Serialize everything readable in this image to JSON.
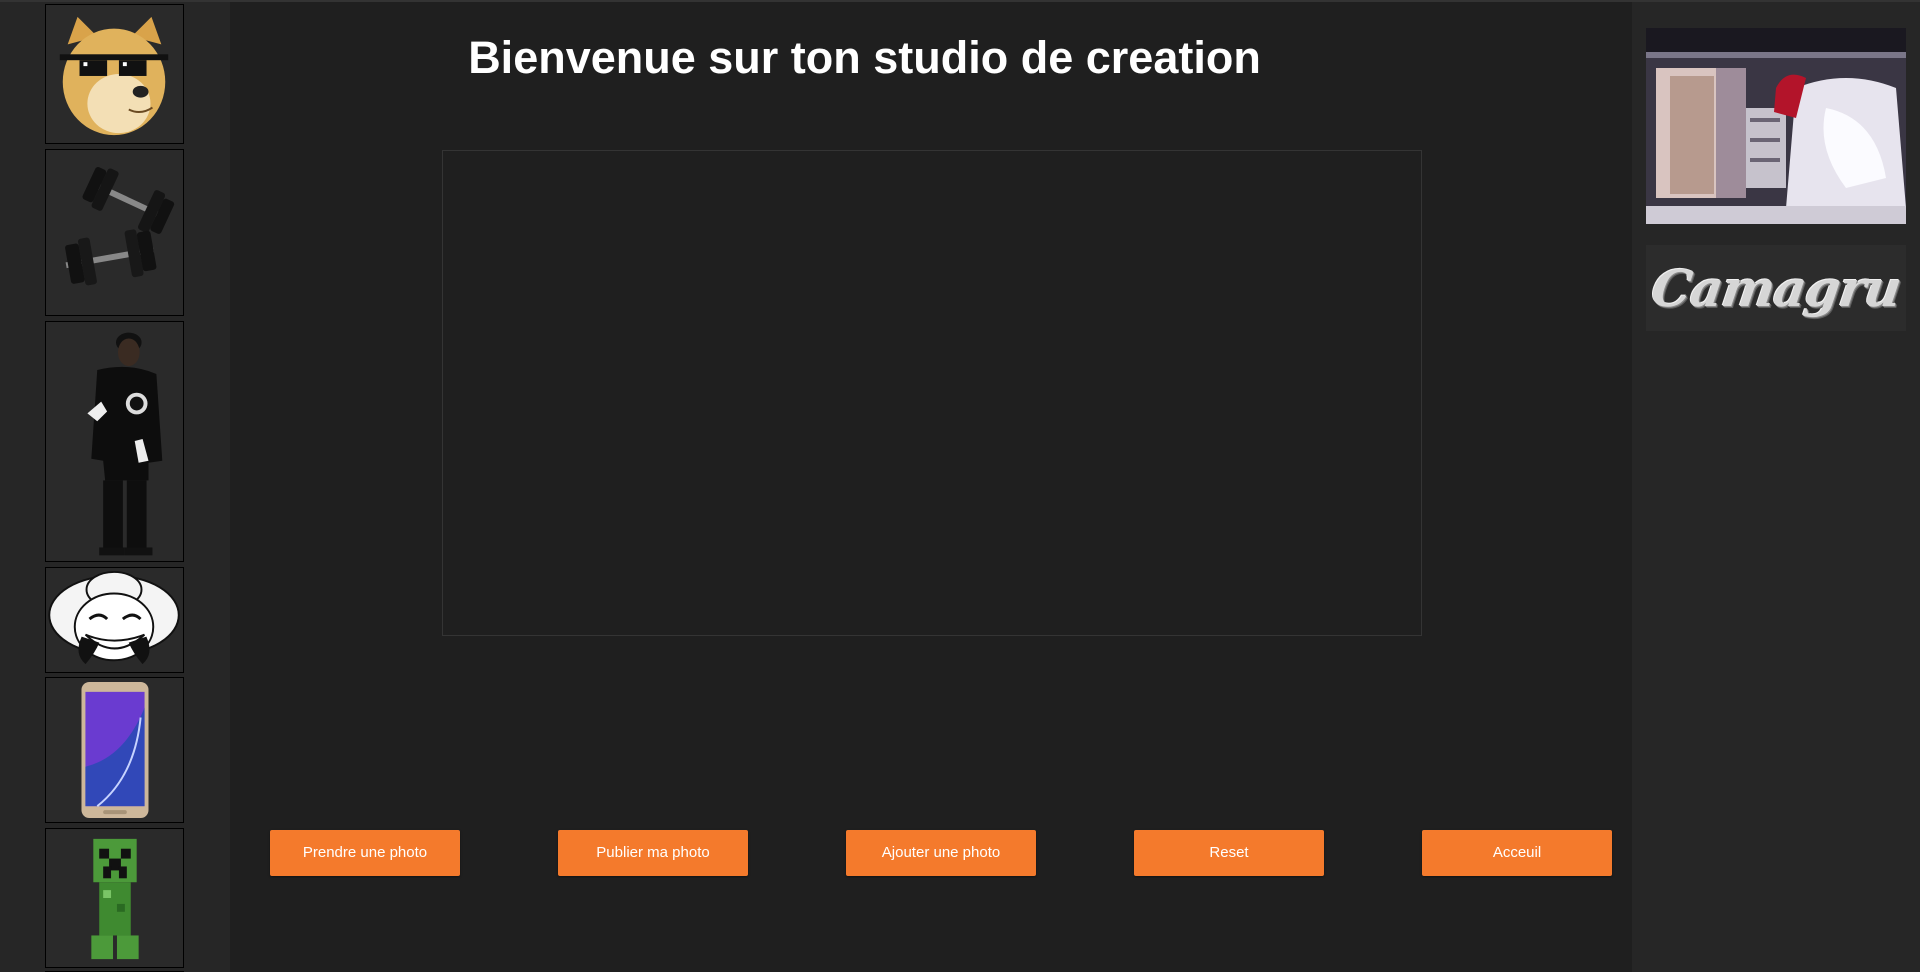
{
  "header": {
    "title": "Bienvenue sur ton studio de creation"
  },
  "stickers": [
    {
      "name": "doge-sunglasses"
    },
    {
      "name": "dumbbells"
    },
    {
      "name": "rapper"
    },
    {
      "name": "troll-face-sombrero"
    },
    {
      "name": "smartphone"
    },
    {
      "name": "creeper"
    }
  ],
  "buttons": {
    "take_photo": "Prendre une photo",
    "publish_photo": "Publier ma photo",
    "add_photo": "Ajouter une photo",
    "reset": "Reset",
    "home": "Acceuil"
  },
  "sidebar_right": {
    "logo_text": "Camagru"
  },
  "colors": {
    "background": "#1f1f1f",
    "sidebar": "#262626",
    "accent": "#f47a2c",
    "text": "#ffffff"
  }
}
